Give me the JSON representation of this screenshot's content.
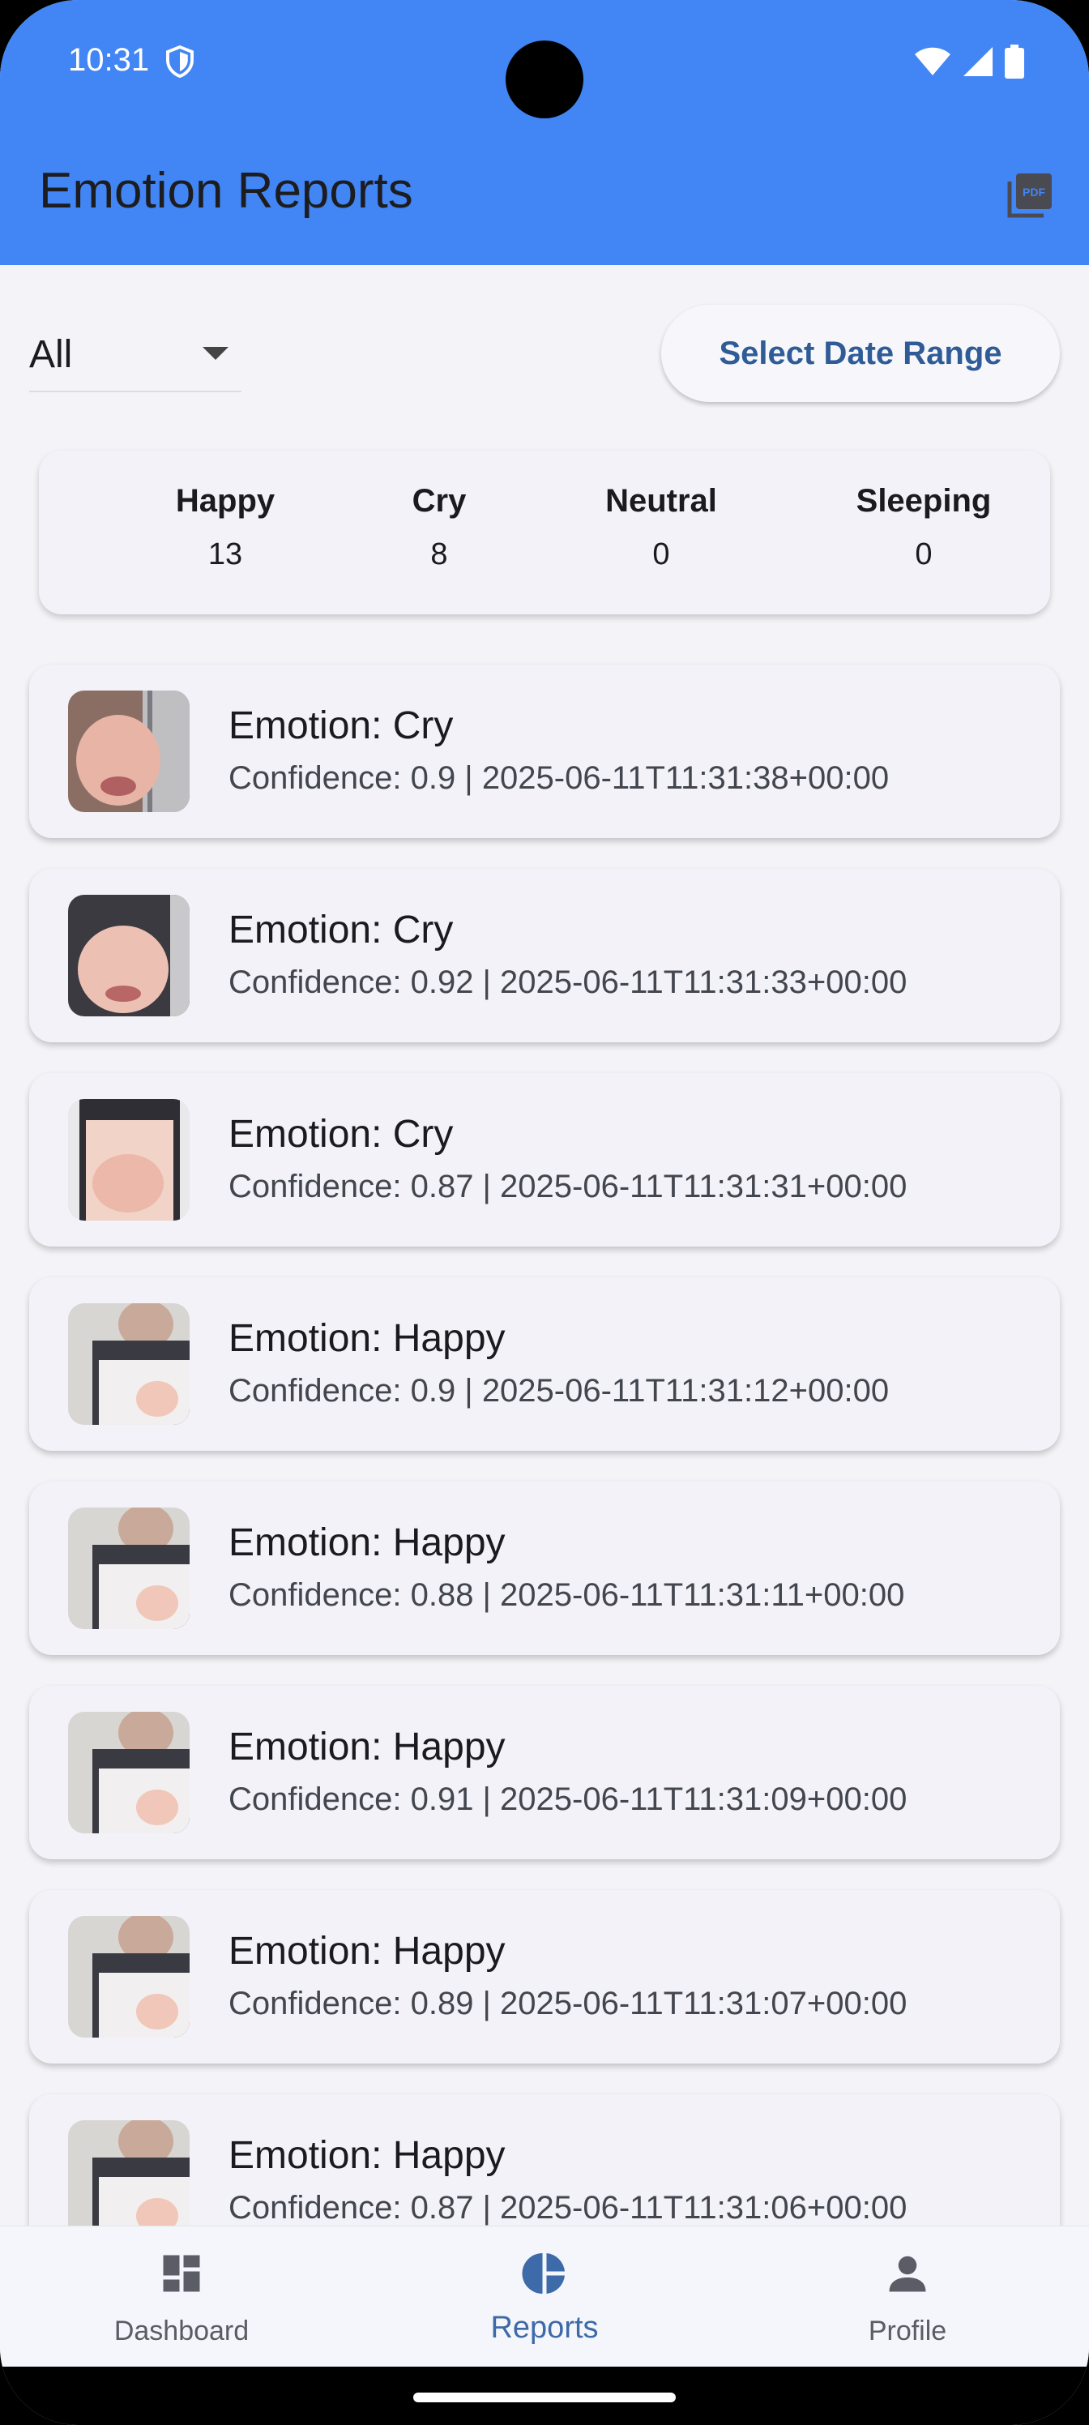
{
  "status_bar": {
    "time": "10:31",
    "icons": [
      "shield-icon",
      "wifi-icon",
      "signal-icon",
      "battery-icon"
    ]
  },
  "app_bar": {
    "title": "Emotion Reports",
    "action_icon": "pdf-icon",
    "color": "#4285f4"
  },
  "filter": {
    "selected": "All",
    "date_range_label": "Select Date Range"
  },
  "stats": [
    {
      "label": "Happy",
      "value": "13"
    },
    {
      "label": "Cry",
      "value": "8"
    },
    {
      "label": "Neutral",
      "value": "0"
    },
    {
      "label": "Sleeping",
      "value": "0"
    }
  ],
  "reports": [
    {
      "emotion": "Emotion: Cry",
      "meta": "Confidence: 0.9 | 2025-06-11T11:31:38+00:00"
    },
    {
      "emotion": "Emotion: Cry",
      "meta": "Confidence: 0.92 | 2025-06-11T11:31:33+00:00"
    },
    {
      "emotion": "Emotion: Cry",
      "meta": "Confidence: 0.87 | 2025-06-11T11:31:31+00:00"
    },
    {
      "emotion": "Emotion: Happy",
      "meta": "Confidence: 0.9 | 2025-06-11T11:31:12+00:00"
    },
    {
      "emotion": "Emotion: Happy",
      "meta": "Confidence: 0.88 | 2025-06-11T11:31:11+00:00"
    },
    {
      "emotion": "Emotion: Happy",
      "meta": "Confidence: 0.91 | 2025-06-11T11:31:09+00:00"
    },
    {
      "emotion": "Emotion: Happy",
      "meta": "Confidence: 0.89 | 2025-06-11T11:31:07+00:00"
    },
    {
      "emotion": "Emotion: Happy",
      "meta": "Confidence: 0.87 | 2025-06-11T11:31:06+00:00"
    }
  ],
  "bottom_nav": [
    {
      "label": "Dashboard",
      "icon": "dashboard-icon",
      "active": false
    },
    {
      "label": "Reports",
      "icon": "pie-chart-icon",
      "active": true
    },
    {
      "label": "Profile",
      "icon": "person-icon",
      "active": false
    }
  ]
}
